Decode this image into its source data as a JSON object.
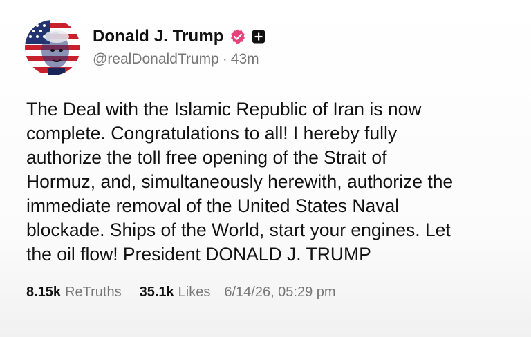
{
  "author": {
    "display_name": "Donald J. Trump",
    "handle": "@realDonaldTrump",
    "separator": "·",
    "time_ago": "43m"
  },
  "post": {
    "body": "The Deal with the Islamic Republic of Iran is now\ncomplete. Congratulations to all! I hereby fully\nauthorize the toll free opening of the Strait of\nHormuz, and, simultaneously herewith, authorize the\nimmediate removal of the United States Naval\nblockade. Ships of the World, start your engines. Let\nthe oil flow! President DONALD J. TRUMP"
  },
  "stats": {
    "retruths_count": "8.15k",
    "retruths_label": "ReTruths",
    "likes_count": "35.1k",
    "likes_label": "Likes",
    "timestamp": "6/14/26, 05:29 pm"
  },
  "colors": {
    "verified_badge": "#e8417a",
    "muted_text": "#777777",
    "text": "#111111"
  },
  "icons": {
    "avatar": "american-flag-portrait-avatar",
    "verified": "verified-badge-icon",
    "plus": "plus-square-icon"
  }
}
